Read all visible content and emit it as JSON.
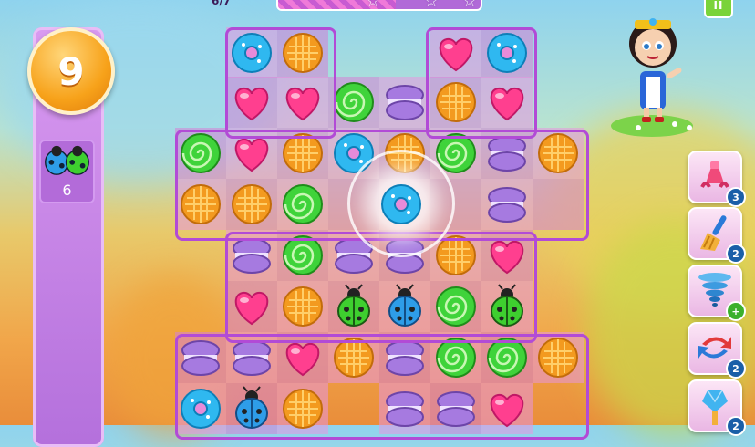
{
  "hud": {
    "score_text": "6/7",
    "moves_left": "9",
    "progress_fraction": 0.58,
    "progress_stars": 3,
    "pause_label": "II"
  },
  "goal": {
    "target_icon": "ladybug-pair-icon",
    "remaining": "6"
  },
  "boosters": [
    {
      "name": "claw-booster",
      "icon": "claw-icon",
      "count": "3",
      "badge": "count"
    },
    {
      "name": "broom-booster",
      "icon": "broom-icon",
      "count": "2",
      "badge": "count"
    },
    {
      "name": "tornado-booster",
      "icon": "tornado-icon",
      "count": "+",
      "badge": "plus"
    },
    {
      "name": "swap-booster",
      "icon": "swap-arrows-icon",
      "count": "2",
      "badge": "count"
    },
    {
      "name": "hammer-booster",
      "icon": "gem-hammer-icon",
      "count": "2",
      "badge": "count"
    }
  ],
  "board": {
    "columns": 8,
    "rows": 8,
    "grid": [
      [
        "",
        "",
        "donut",
        "waffle",
        "",
        "",
        "heart",
        "donut"
      ],
      [
        "",
        "",
        "heart",
        "heart",
        "roll",
        "macaron",
        "waffle",
        "heart"
      ],
      [
        "",
        "roll",
        "heart",
        "waffle",
        "donut",
        "waffle",
        "roll",
        "macaron",
        "waffle"
      ],
      [
        "",
        "waffle",
        "waffle",
        "roll",
        "",
        "",
        "",
        "macaron"
      ],
      [
        "",
        "",
        "macaron",
        "roll",
        "macaron",
        "macaron",
        "waffle",
        "heart"
      ],
      [
        "",
        "",
        "heart",
        "waffle",
        "ladybug-green",
        "ladybug-blue",
        "roll",
        "ladybug-green"
      ],
      [
        "",
        "macaron",
        "macaron",
        "heart",
        "waffle",
        "macaron",
        "roll",
        "roll",
        "waffle"
      ],
      [
        "",
        "donut",
        "ladybug-blue",
        "waffle",
        "",
        "macaron",
        "macaron",
        "heart"
      ]
    ],
    "highlight_piece": "donut"
  },
  "colors": {
    "heart": "#ff3f8f",
    "donut": "#2fb8f0",
    "waffle": "#f39a1f",
    "roll": "#3fd33a",
    "macaron": "#a67ae0",
    "ladybug_green": "#3ecf2f",
    "ladybug_blue": "#2e9de8"
  }
}
